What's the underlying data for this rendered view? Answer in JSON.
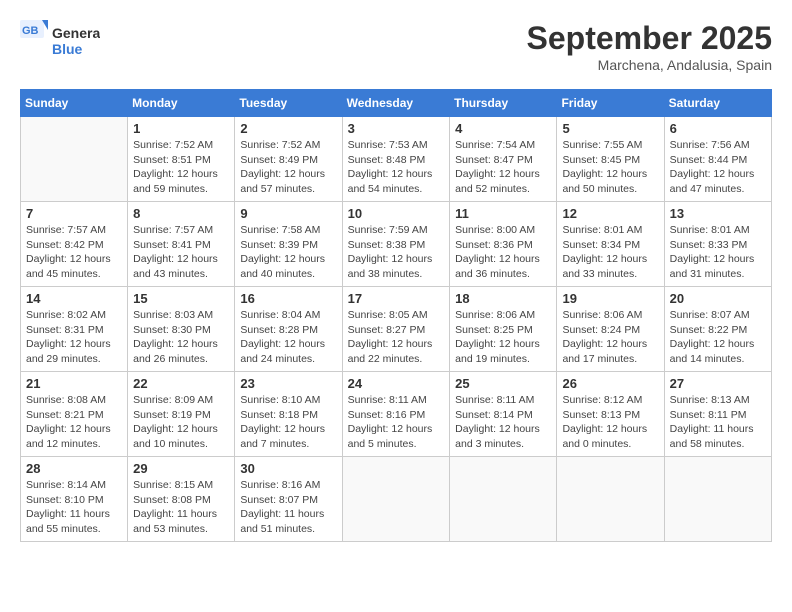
{
  "header": {
    "logo_line1": "General",
    "logo_line2": "Blue",
    "month": "September 2025",
    "location": "Marchena, Andalusia, Spain"
  },
  "weekdays": [
    "Sunday",
    "Monday",
    "Tuesday",
    "Wednesday",
    "Thursday",
    "Friday",
    "Saturday"
  ],
  "weeks": [
    [
      {
        "day": "",
        "info": ""
      },
      {
        "day": "1",
        "info": "Sunrise: 7:52 AM\nSunset: 8:51 PM\nDaylight: 12 hours\nand 59 minutes."
      },
      {
        "day": "2",
        "info": "Sunrise: 7:52 AM\nSunset: 8:49 PM\nDaylight: 12 hours\nand 57 minutes."
      },
      {
        "day": "3",
        "info": "Sunrise: 7:53 AM\nSunset: 8:48 PM\nDaylight: 12 hours\nand 54 minutes."
      },
      {
        "day": "4",
        "info": "Sunrise: 7:54 AM\nSunset: 8:47 PM\nDaylight: 12 hours\nand 52 minutes."
      },
      {
        "day": "5",
        "info": "Sunrise: 7:55 AM\nSunset: 8:45 PM\nDaylight: 12 hours\nand 50 minutes."
      },
      {
        "day": "6",
        "info": "Sunrise: 7:56 AM\nSunset: 8:44 PM\nDaylight: 12 hours\nand 47 minutes."
      }
    ],
    [
      {
        "day": "7",
        "info": "Sunrise: 7:57 AM\nSunset: 8:42 PM\nDaylight: 12 hours\nand 45 minutes."
      },
      {
        "day": "8",
        "info": "Sunrise: 7:57 AM\nSunset: 8:41 PM\nDaylight: 12 hours\nand 43 minutes."
      },
      {
        "day": "9",
        "info": "Sunrise: 7:58 AM\nSunset: 8:39 PM\nDaylight: 12 hours\nand 40 minutes."
      },
      {
        "day": "10",
        "info": "Sunrise: 7:59 AM\nSunset: 8:38 PM\nDaylight: 12 hours\nand 38 minutes."
      },
      {
        "day": "11",
        "info": "Sunrise: 8:00 AM\nSunset: 8:36 PM\nDaylight: 12 hours\nand 36 minutes."
      },
      {
        "day": "12",
        "info": "Sunrise: 8:01 AM\nSunset: 8:34 PM\nDaylight: 12 hours\nand 33 minutes."
      },
      {
        "day": "13",
        "info": "Sunrise: 8:01 AM\nSunset: 8:33 PM\nDaylight: 12 hours\nand 31 minutes."
      }
    ],
    [
      {
        "day": "14",
        "info": "Sunrise: 8:02 AM\nSunset: 8:31 PM\nDaylight: 12 hours\nand 29 minutes."
      },
      {
        "day": "15",
        "info": "Sunrise: 8:03 AM\nSunset: 8:30 PM\nDaylight: 12 hours\nand 26 minutes."
      },
      {
        "day": "16",
        "info": "Sunrise: 8:04 AM\nSunset: 8:28 PM\nDaylight: 12 hours\nand 24 minutes."
      },
      {
        "day": "17",
        "info": "Sunrise: 8:05 AM\nSunset: 8:27 PM\nDaylight: 12 hours\nand 22 minutes."
      },
      {
        "day": "18",
        "info": "Sunrise: 8:06 AM\nSunset: 8:25 PM\nDaylight: 12 hours\nand 19 minutes."
      },
      {
        "day": "19",
        "info": "Sunrise: 8:06 AM\nSunset: 8:24 PM\nDaylight: 12 hours\nand 17 minutes."
      },
      {
        "day": "20",
        "info": "Sunrise: 8:07 AM\nSunset: 8:22 PM\nDaylight: 12 hours\nand 14 minutes."
      }
    ],
    [
      {
        "day": "21",
        "info": "Sunrise: 8:08 AM\nSunset: 8:21 PM\nDaylight: 12 hours\nand 12 minutes."
      },
      {
        "day": "22",
        "info": "Sunrise: 8:09 AM\nSunset: 8:19 PM\nDaylight: 12 hours\nand 10 minutes."
      },
      {
        "day": "23",
        "info": "Sunrise: 8:10 AM\nSunset: 8:18 PM\nDaylight: 12 hours\nand 7 minutes."
      },
      {
        "day": "24",
        "info": "Sunrise: 8:11 AM\nSunset: 8:16 PM\nDaylight: 12 hours\nand 5 minutes."
      },
      {
        "day": "25",
        "info": "Sunrise: 8:11 AM\nSunset: 8:14 PM\nDaylight: 12 hours\nand 3 minutes."
      },
      {
        "day": "26",
        "info": "Sunrise: 8:12 AM\nSunset: 8:13 PM\nDaylight: 12 hours\nand 0 minutes."
      },
      {
        "day": "27",
        "info": "Sunrise: 8:13 AM\nSunset: 8:11 PM\nDaylight: 11 hours\nand 58 minutes."
      }
    ],
    [
      {
        "day": "28",
        "info": "Sunrise: 8:14 AM\nSunset: 8:10 PM\nDaylight: 11 hours\nand 55 minutes."
      },
      {
        "day": "29",
        "info": "Sunrise: 8:15 AM\nSunset: 8:08 PM\nDaylight: 11 hours\nand 53 minutes."
      },
      {
        "day": "30",
        "info": "Sunrise: 8:16 AM\nSunset: 8:07 PM\nDaylight: 11 hours\nand 51 minutes."
      },
      {
        "day": "",
        "info": ""
      },
      {
        "day": "",
        "info": ""
      },
      {
        "day": "",
        "info": ""
      },
      {
        "day": "",
        "info": ""
      }
    ]
  ]
}
